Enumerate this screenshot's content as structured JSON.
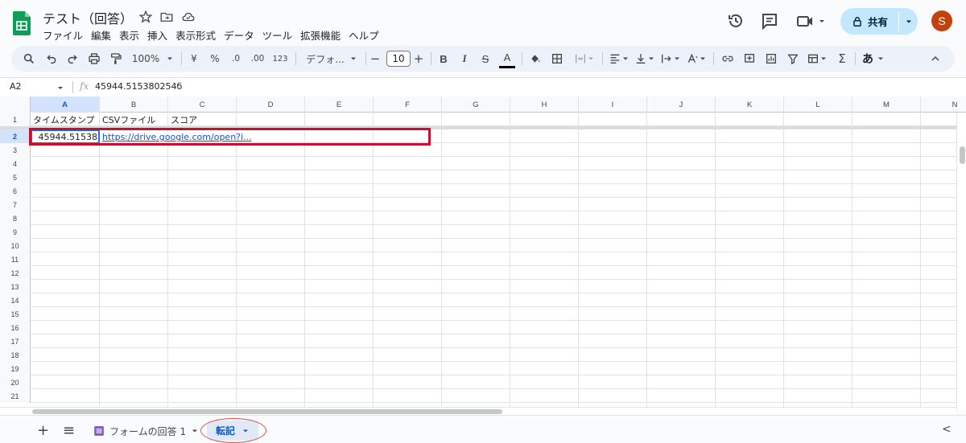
{
  "header": {
    "title": "テスト（回答）",
    "menu": [
      "ファイル",
      "編集",
      "表示",
      "挿入",
      "表示形式",
      "データ",
      "ツール",
      "拡張機能",
      "ヘルプ"
    ],
    "share_label": "共有",
    "avatar_letter": "S"
  },
  "toolbar": {
    "zoom": "100%",
    "currency": "¥",
    "percent": "%",
    "dec_decrease": ".0",
    "dec_increase": ".00",
    "number_format": "123",
    "font": "デフォ...",
    "font_size": "10",
    "minus": "−",
    "plus": "+",
    "bold": "B",
    "italic": "I",
    "strike": "S",
    "text_color": "A",
    "input_tools": "あ"
  },
  "formula_bar": {
    "name_box": "A2",
    "fx": "fx",
    "content": "45944.515380254б"
  },
  "grid": {
    "columns": [
      "A",
      "B",
      "C",
      "D",
      "E",
      "F",
      "G",
      "H",
      "I",
      "J",
      "K",
      "L",
      "M",
      "N"
    ],
    "rows": [
      "1",
      "2",
      "3",
      "4",
      "5",
      "6",
      "7",
      "8",
      "9",
      "10",
      "11",
      "12",
      "13",
      "14",
      "15",
      "16",
      "17",
      "18",
      "19",
      "20",
      "21"
    ],
    "header_row": {
      "a": "タイムスタンプ",
      "b": "CSVファイル",
      "c": "スコア"
    },
    "data_row": {
      "a": "45944.51538",
      "b": "https://drive.google.com/open?i..."
    }
  },
  "sheets": {
    "add": "+",
    "all": "≡",
    "tab1": "フォームの回答 1",
    "tab2": "転記"
  },
  "colors": {
    "accent": "#0b57d0",
    "share_bg": "#c2e7ff",
    "highlight_red": "#c8102e",
    "logo_green": "#0f9d58"
  }
}
